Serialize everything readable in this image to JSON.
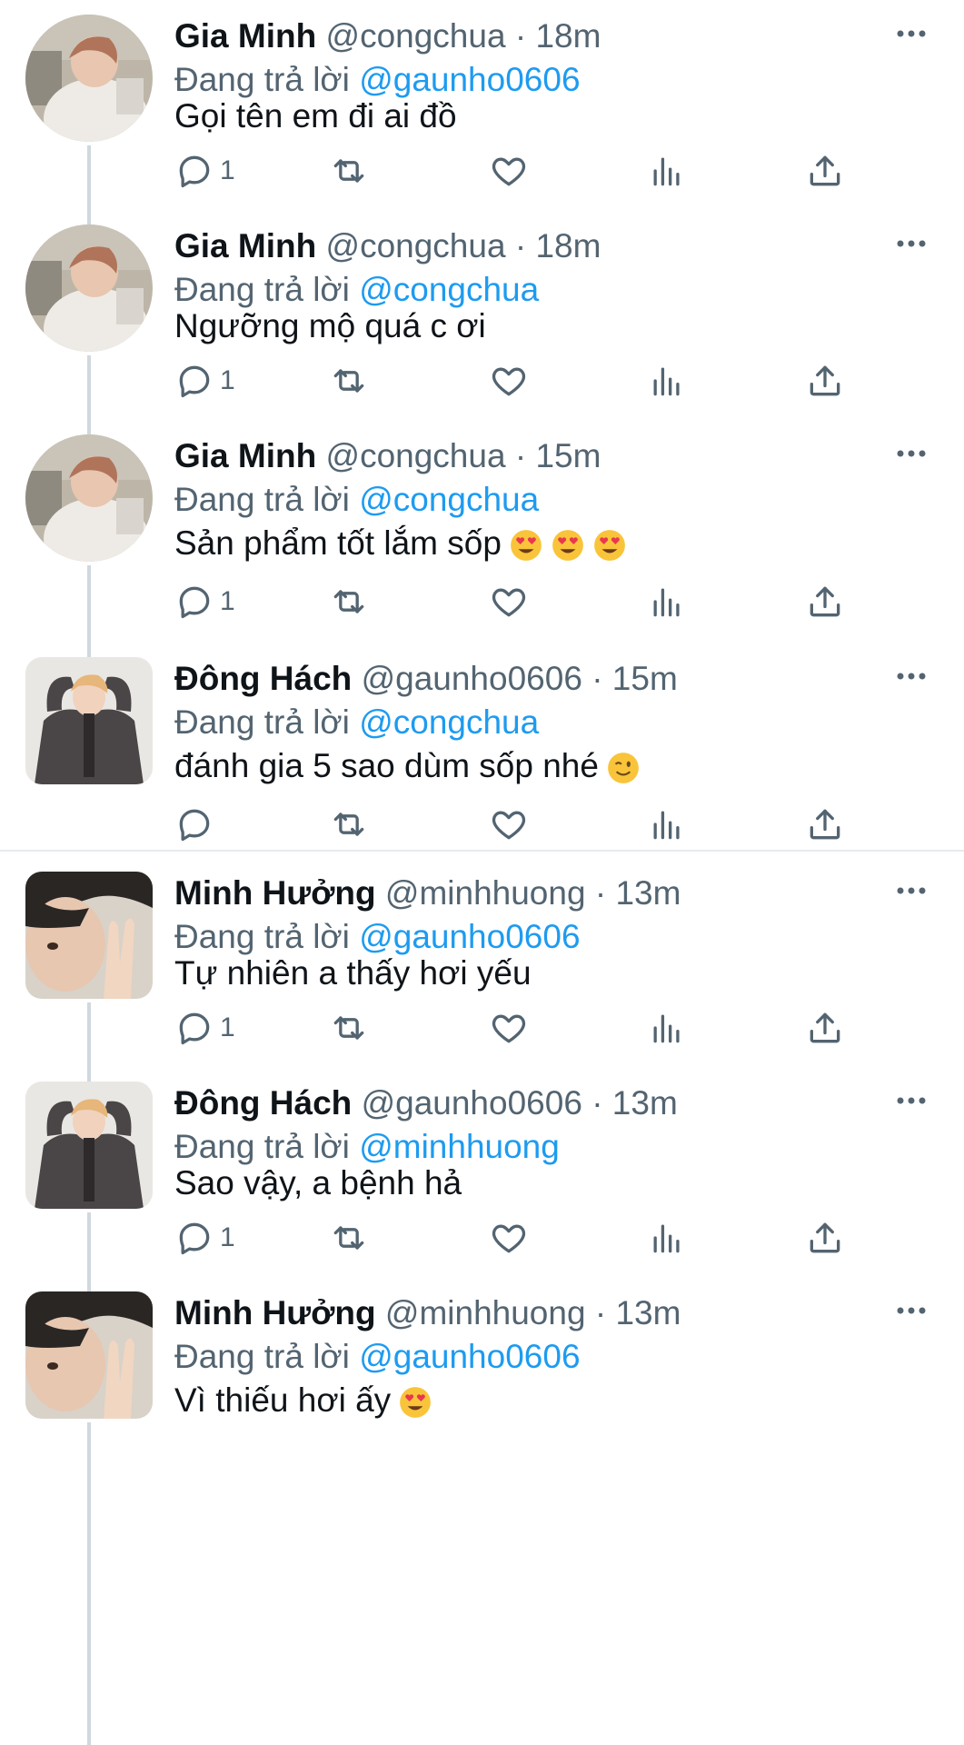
{
  "labels": {
    "reply_prefix": "Đang trả lời"
  },
  "tweets": [
    {
      "name": "Gia Minh",
      "handle": "@congchua",
      "time": "18m",
      "reply_to": "@gaunho0606",
      "text": "Gọi tên em đi ai đồ",
      "emoji_count": 0,
      "reply_count": "1",
      "avatar": "gia-minh"
    },
    {
      "name": "Gia Minh",
      "handle": "@congchua",
      "time": "18m",
      "reply_to": "@congchua",
      "text": "Ngưỡng mộ quá c ơi",
      "emoji_count": 0,
      "reply_count": "1",
      "avatar": "gia-minh"
    },
    {
      "name": "Gia Minh",
      "handle": "@congchua",
      "time": "15m",
      "reply_to": "@congchua",
      "text": "Sản phẩm tốt lắm sốp",
      "emoji": "heart-eyes",
      "emoji_count": 3,
      "reply_count": "1",
      "avatar": "gia-minh"
    },
    {
      "name": "Đông Hách",
      "handle": "@gaunho0606",
      "time": "15m",
      "reply_to": "@congchua",
      "text": "đánh gia 5 sao dùm sốp nhé",
      "emoji": "wink",
      "emoji_count": 1,
      "reply_count": "",
      "avatar": "dong-hach"
    },
    {
      "name": "Minh Hưởng",
      "handle": "@minhhuong",
      "time": "13m",
      "reply_to": "@gaunho0606",
      "text": "Tự nhiên a thấy hơi yếu",
      "emoji_count": 0,
      "reply_count": "1",
      "avatar": "minh-huong"
    },
    {
      "name": "Đông Hách",
      "handle": "@gaunho0606",
      "time": "13m",
      "reply_to": "@minhhuong",
      "text": "Sao vậy, a bệnh hả",
      "emoji_count": 0,
      "reply_count": "1",
      "avatar": "dong-hach"
    },
    {
      "name": "Minh Hưởng",
      "handle": "@minhhuong",
      "time": "13m",
      "reply_to": "@gaunho0606",
      "text": "Vì thiếu hơi ấy",
      "emoji": "heart-eyes",
      "emoji_count": 1,
      "reply_count": "",
      "avatar": "minh-huong"
    }
  ],
  "icons": {
    "more": "more-dots-icon",
    "reply": "reply-icon",
    "retweet": "retweet-icon",
    "like": "heart-icon",
    "views": "views-bar-chart-icon",
    "share": "share-icon"
  },
  "colors": {
    "mention": "#1d9bf0",
    "secondary": "#536471",
    "text": "#0f1419",
    "divider": "#e6ecf0"
  }
}
